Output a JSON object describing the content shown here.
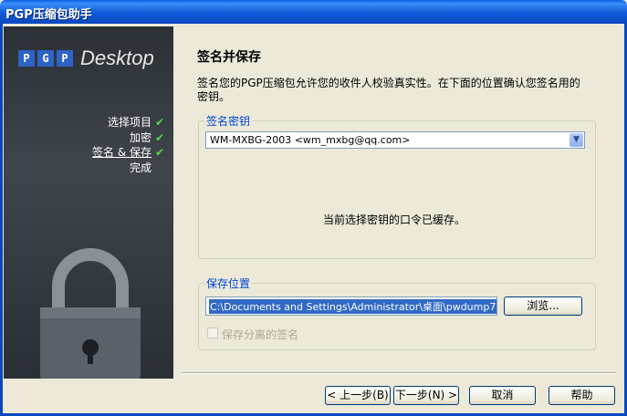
{
  "window": {
    "title": "PGP压缩包助手"
  },
  "brand": {
    "letters": [
      "P",
      "G",
      "P"
    ],
    "product": "Desktop"
  },
  "steps": [
    {
      "label": "选择项目",
      "done": true,
      "current": false
    },
    {
      "label": "加密",
      "done": true,
      "current": false
    },
    {
      "label": "签名 & 保存",
      "done": true,
      "current": true
    },
    {
      "label": "完成",
      "done": false,
      "current": false
    }
  ],
  "page": {
    "title": "签名并保存",
    "description": "签名您的PGP压缩包允许您的收件人校验真实性。在下面的位置确认您签名用的密钥。"
  },
  "signing_key": {
    "legend": "签名密钥",
    "selected": "WM-MXBG-2003 <wm_mxbg@qq.com>",
    "cache_message": "当前选择密钥的口令已缓存。"
  },
  "save_location": {
    "legend": "保存位置",
    "path": "C:\\Documents and Settings\\Administrator\\桌面\\pwdump7",
    "browse_label": "浏览...",
    "detached_signature_label": "保存分离的签名"
  },
  "buttons": {
    "back": "< 上一步(B)",
    "next": "下一步(N) >",
    "cancel": "取消",
    "help": "帮助"
  },
  "colors": {
    "accent": "#0046d5",
    "selection": "#316ac5",
    "check": "#55d84a"
  }
}
